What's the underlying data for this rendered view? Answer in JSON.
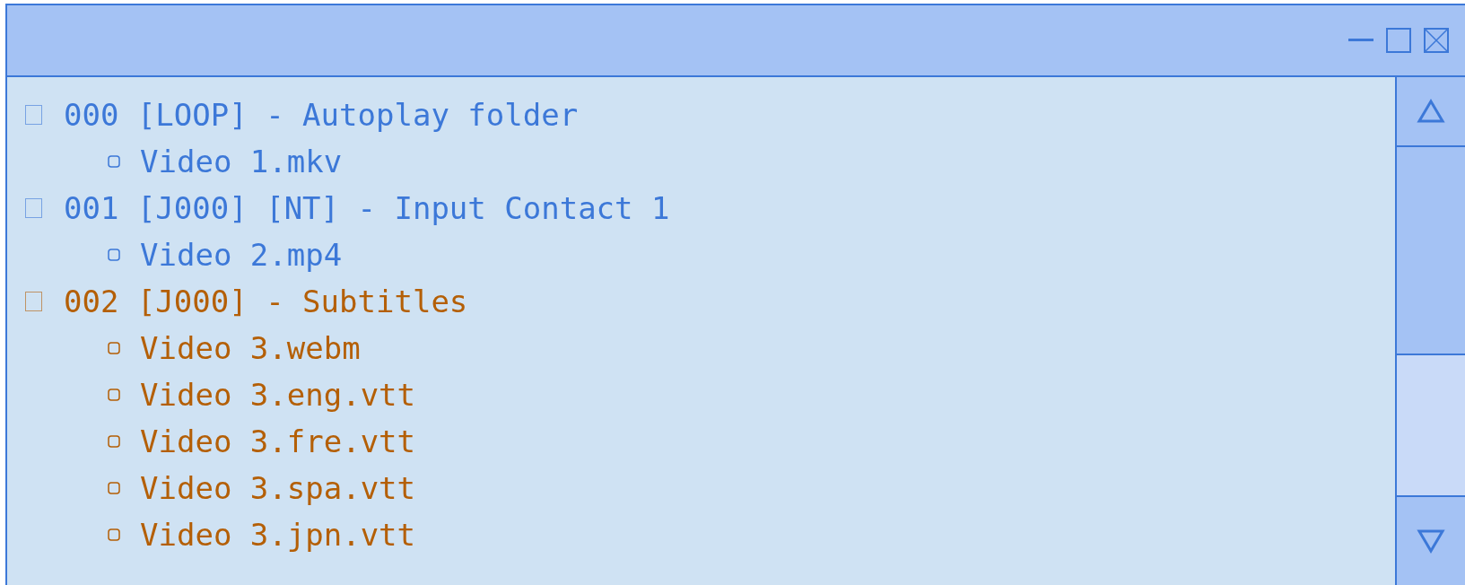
{
  "tree": [
    {
      "label": "000 [LOOP] - Autoplay folder",
      "color": "#3c78d8",
      "children": [
        {
          "label": "Video 1.mkv"
        }
      ]
    },
    {
      "label": "001 [J000] [NT] - Input Contact 1",
      "color": "#3c78d8",
      "children": [
        {
          "label": "Video 2.mp4"
        }
      ]
    },
    {
      "label": "002 [J000] - Subtitles",
      "color": "#b45f06",
      "children": [
        {
          "label": "Video 3.webm"
        },
        {
          "label": "Video 3.eng.vtt"
        },
        {
          "label": "Video 3.fre.vtt"
        },
        {
          "label": "Video 3.spa.vtt"
        },
        {
          "label": "Video 3.jpn.vtt"
        }
      ]
    }
  ]
}
